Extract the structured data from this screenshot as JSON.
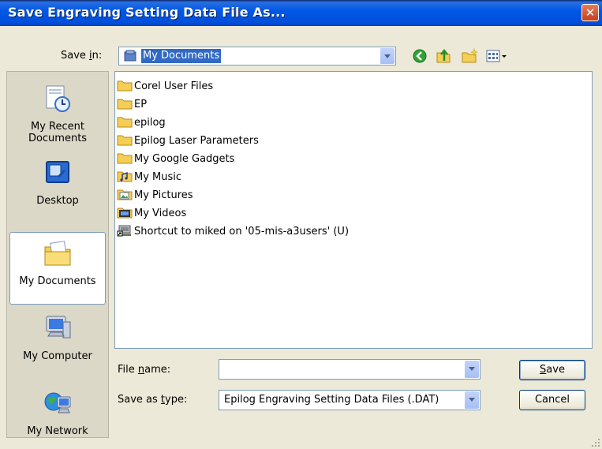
{
  "window": {
    "title": "Save Engraving Setting Data File As..."
  },
  "toolbar": {
    "save_in_label_pre": "Save ",
    "save_in_label_key": "i",
    "save_in_label_post": "n:",
    "save_in_value": "My Documents",
    "icons": [
      "back-icon",
      "up-folder-icon",
      "new-folder-icon",
      "views-menu-icon"
    ]
  },
  "places": [
    {
      "label_line1": "My Recent",
      "label_line2": "Documents"
    },
    {
      "label_line1": "Desktop",
      "label_line2": ""
    },
    {
      "label_line1": "My Documents",
      "label_line2": ""
    },
    {
      "label_line1": "My Computer",
      "label_line2": ""
    },
    {
      "label_line1": "My Network",
      "label_line2": ""
    }
  ],
  "files": [
    {
      "name": "Corel User Files",
      "icon": "folder-icon"
    },
    {
      "name": "EP",
      "icon": "folder-icon"
    },
    {
      "name": "epilog",
      "icon": "folder-icon"
    },
    {
      "name": "Epilog Laser Parameters",
      "icon": "folder-icon"
    },
    {
      "name": "My Google Gadgets",
      "icon": "folder-icon"
    },
    {
      "name": "My Music",
      "icon": "music-folder-icon"
    },
    {
      "name": "My Pictures",
      "icon": "pictures-folder-icon"
    },
    {
      "name": "My Videos",
      "icon": "videos-folder-icon"
    },
    {
      "name": "Shortcut to miked on '05-mis-a3users' (U)",
      "icon": "network-shortcut-icon"
    }
  ],
  "form": {
    "filename_label_pre": "File ",
    "filename_label_key": "n",
    "filename_label_post": "ame:",
    "filename_value": "",
    "savetype_label_pre": "Save as ",
    "savetype_label_key": "t",
    "savetype_label_post": "ype:",
    "savetype_value": "Epilog Engraving Setting Data Files (.DAT)"
  },
  "buttons": {
    "save_key": "S",
    "save_rest": "ave",
    "cancel": "Cancel"
  },
  "colors": {
    "titlebar": "#0054e3",
    "close": "#d9542c",
    "face": "#ece9d8",
    "selection": "#316ac5"
  }
}
